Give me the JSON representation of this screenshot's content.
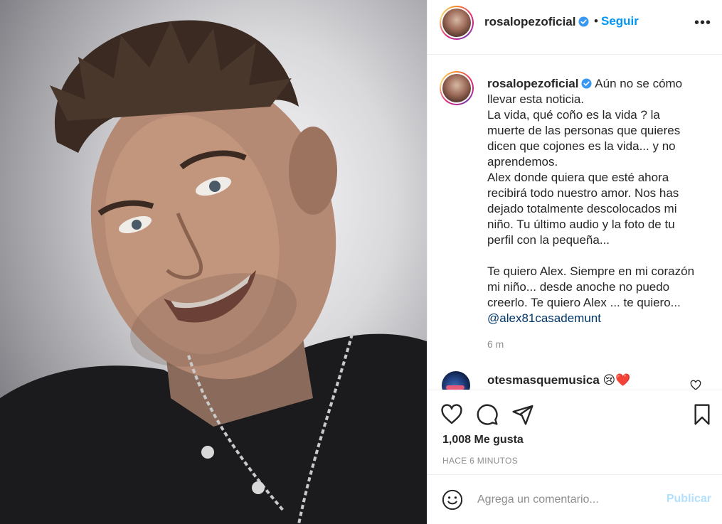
{
  "post": {
    "username": "rosalopezoficial",
    "separator": "•",
    "follow_label": "Seguir",
    "more_label": "•••",
    "caption": "Aún no se cómo\nllevar esta noticia.\nLa vida, qué coño es la vida ? la\nmuerte de las personas que quieres\ndicen que cojones es la vida... y no\naprendemos.\nAlex donde quiera que esté ahora\nrecibirá todo nuestro amor. Nos has\ndejado totalmente descolocados mi\nniño. Tu último audio y la foto de tu\nperfil con la pequeña...\n\nTe quiero Alex. Siempre en mi corazón\nmi niño... desde anoche no puedo\ncreerlo. Te quiero Alex ... te quiero...",
    "mention": "@alex81casademunt",
    "time": "6 m",
    "likes": "1,008 Me gusta",
    "posted_ago": "Hace 6 minutos"
  },
  "comments": [
    {
      "username": "otesmasquemusica",
      "text": "😢❤️"
    }
  ],
  "composer": {
    "placeholder": "Agrega un comentario...",
    "publish_label": "Publicar"
  },
  "colors": {
    "accent": "#0095f6",
    "publish_disabled": "#b2dffc",
    "mention": "#00376b",
    "muted": "#8e8e8e"
  },
  "icons": [
    "verified-icon",
    "more-icon",
    "heart-icon",
    "comment-icon",
    "share-icon",
    "bookmark-icon",
    "emoji-icon"
  ]
}
